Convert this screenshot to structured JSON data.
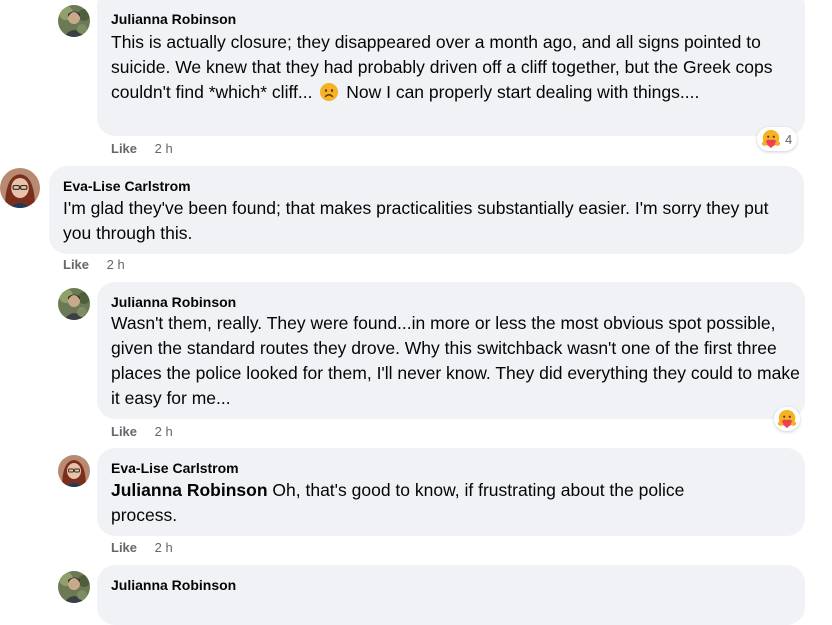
{
  "comments": [
    {
      "author": "Julianna Robinson",
      "text_part1": "This is actually closure; they disappeared over a month ago, and all signs pointed to suicide. We knew that they had probably driven off a cliff together, but the Greek cops couldn't find *which* cliff...",
      "text_part2": "Now I can properly start dealing with things....",
      "inline_emoji": "sad-face-emoji",
      "like_label": "Like",
      "time": "2 h",
      "reaction": {
        "icon": "care-reaction-icon",
        "count": "4"
      }
    },
    {
      "author": "Eva-Lise Carlstrom",
      "text": "I'm glad they've been found; that makes practicalities substantially easier. I'm sorry they put you through this.",
      "like_label": "Like",
      "time": "2 h"
    },
    {
      "author": "Julianna Robinson",
      "text": "Wasn't them, really. They were found...in more or less the most obvious spot possible, given the standard routes they drove. Why this switchback wasn't one of the first three places the police looked for them, I'll never know. They did everything they could to make it easy for me...",
      "like_label": "Like",
      "time": "2 h",
      "reaction": {
        "icon": "care-reaction-icon"
      }
    },
    {
      "author": "Eva-Lise Carlstrom",
      "mention": "Julianna Robinson",
      "text": " Oh, that's good to know, if frustrating about the police process.",
      "like_label": "Like",
      "time": "2 h"
    },
    {
      "author": "Julianna Robinson"
    }
  ],
  "colors": {
    "bubble": "#f0f2f5",
    "meta": "#65676b",
    "text": "#050505"
  }
}
